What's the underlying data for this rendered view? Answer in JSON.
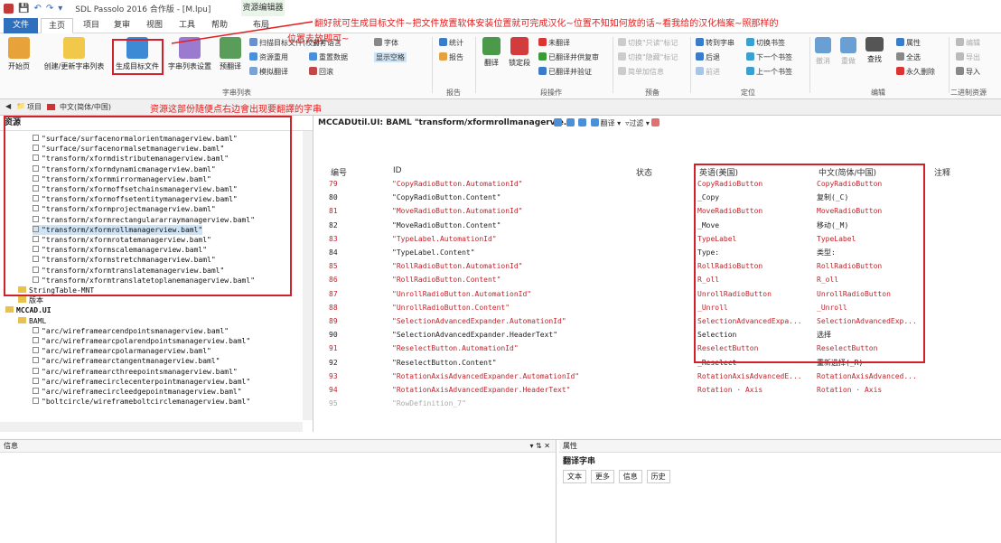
{
  "titlebar": {
    "title": "SDL Passolo 2016 合作版 - [M.lpu]",
    "context_tab": "资源编辑器"
  },
  "tabs": {
    "file": "文件",
    "home": "主页",
    "project": "项目",
    "review": "复审",
    "view": "视图",
    "tools": "工具",
    "help": "帮助",
    "layout": "布局"
  },
  "ribbon": {
    "start": "开始页",
    "create": "创建/更新字串列表",
    "generate": "生成目标文件",
    "list_settings": "字串列表设置",
    "pretranslate": "预翻译",
    "scan": "扫描目标文件(校对)",
    "reuse": "资源重用",
    "simulate": "模拟翻译",
    "ref_lang": "参考语言",
    "reset_data": "重置数据",
    "undo": "回滚",
    "font": "字体",
    "show_space": "显示空格",
    "stats": "统计",
    "report": "报告",
    "translate": "翻译",
    "lock": "锁定段",
    "untranslated": "未翻译",
    "translated_review": "已翻译并供复审",
    "translated_verified": "已翻译并验证",
    "switch_for": "切换\"只读\"标记",
    "switch_hidden": "切换\"隐藏\"标记",
    "add_memo": "简单加信息",
    "goto": "转到字串",
    "toggle_bookmark": "切换书签",
    "back": "后退",
    "next_bookmark": "下一个书签",
    "forward": "前进",
    "prev_bookmark": "上一个书签",
    "undo2": "撤消",
    "redo": "重做",
    "find": "查找",
    "properties": "属性",
    "select_all": "全选",
    "perm_delete": "永久删除",
    "edit": "编辑",
    "export": "导出",
    "import": "导入",
    "groups": {
      "string_list": "字串列表",
      "report": "报告",
      "para_ops": "段操作",
      "pretrans": "预备",
      "locate": "定位",
      "editing": "编辑",
      "binary": "二进制资源"
    }
  },
  "annotations": {
    "top": "翻好就可生成目标文件~把文件放置软体安装位置就可完成汉化~位置不知如何放的话~看我给的汉化档案~照那样的",
    "top2": "位置去放即可~",
    "left": "资源这部份随便点右边會出现要翻譯的字串"
  },
  "docbar": {
    "project": "项目",
    "lang": "中文(简体/中国)"
  },
  "leftpanel": {
    "title": "资源",
    "rows": [
      {
        "text": "\"surface/surfacenormalorientmanagerview.baml\"",
        "kind": "file",
        "indent": 36
      },
      {
        "text": "\"surface/surfacenormalsetmanagerview.baml\"",
        "kind": "file",
        "indent": 36
      },
      {
        "text": "\"transform/xformdistributemanagerview.baml\"",
        "kind": "file",
        "indent": 36
      },
      {
        "text": "\"transform/xformdynamicmanagerview.baml\"",
        "kind": "file",
        "indent": 36
      },
      {
        "text": "\"transform/xformmirrormanagerview.baml\"",
        "kind": "file",
        "indent": 36
      },
      {
        "text": "\"transform/xformoffsetchainsmanagerview.baml\"",
        "kind": "file",
        "indent": 36
      },
      {
        "text": "\"transform/xformoffsetentitymanagerview.baml\"",
        "kind": "file",
        "indent": 36
      },
      {
        "text": "\"transform/xformprojectmanagerview.baml\"",
        "kind": "file",
        "indent": 36
      },
      {
        "text": "\"transform/xformrectangulararraymanagerview.baml\"",
        "kind": "file",
        "indent": 36
      },
      {
        "text": "\"transform/xformrollmanagerview.baml\"",
        "kind": "file",
        "indent": 36,
        "selected": true
      },
      {
        "text": "\"transform/xformrotatemanagerview.baml\"",
        "kind": "file",
        "indent": 36
      },
      {
        "text": "\"transform/xformscalemanagerview.baml\"",
        "kind": "file",
        "indent": 36
      },
      {
        "text": "\"transform/xformstretchmanagerview.baml\"",
        "kind": "file",
        "indent": 36
      },
      {
        "text": "\"transform/xformtranslatemanagerview.baml\"",
        "kind": "file",
        "indent": 36
      },
      {
        "text": "\"transform/xformtranslatetoplanemanagerview.baml\"",
        "kind": "file",
        "indent": 36
      },
      {
        "text": "StringTable-MNT",
        "kind": "folder",
        "indent": 20
      },
      {
        "text": "版本",
        "kind": "folder",
        "indent": 20
      },
      {
        "text": "MCCAD.UI",
        "kind": "root",
        "indent": 6
      },
      {
        "text": "BAML",
        "kind": "folder",
        "indent": 20
      },
      {
        "text": "\"arc/wireframearcendpointsmanagerview.baml\"",
        "kind": "file",
        "indent": 36
      },
      {
        "text": "\"arc/wireframearcpolarendpointsmanagerview.baml\"",
        "kind": "file",
        "indent": 36
      },
      {
        "text": "\"arc/wireframearcpolarmanagerview.baml\"",
        "kind": "file",
        "indent": 36
      },
      {
        "text": "\"arc/wireframearctangentmanagerview.baml\"",
        "kind": "file",
        "indent": 36
      },
      {
        "text": "\"arc/wireframearcthreepointsmanagerview.baml\"",
        "kind": "file",
        "indent": 36
      },
      {
        "text": "\"arc/wireframecirclecenterpointmanagerview.baml\"",
        "kind": "file",
        "indent": 36
      },
      {
        "text": "\"arc/wireframecircleedgepointmanagerview.baml\"",
        "kind": "file",
        "indent": 36
      },
      {
        "text": "\"boltcircle/wireframeboltcirclemanagerview.baml\"",
        "kind": "file",
        "indent": 36
      }
    ]
  },
  "main": {
    "header": "MCCADUtil.UI: BAML \"transform/xformrollmanagervie...",
    "translate_label": "翻译",
    "filter_label": "过滤",
    "columns": {
      "num": "编号",
      "id": "ID",
      "status": "状态",
      "en": "英语(美国)",
      "zh": "中文(简体/中国)",
      "comment": "注释"
    },
    "rows": [
      {
        "num": "79",
        "id": "\"CopyRadioButton.AutomationId\"",
        "en": "CopyRadioButton",
        "zh": "CopyRadioButton",
        "red": true
      },
      {
        "num": "80",
        "id": "\"CopyRadioButton.Content\"",
        "en": "_Copy",
        "zh": "复制(_C)",
        "red": false
      },
      {
        "num": "81",
        "id": "\"MoveRadioButton.AutomationId\"",
        "en": "MoveRadioButton",
        "zh": "MoveRadioButton",
        "red": true
      },
      {
        "num": "82",
        "id": "\"MoveRadioButton.Content\"",
        "en": "_Move",
        "zh": "移动(_M)",
        "red": false
      },
      {
        "num": "83",
        "id": "\"TypeLabel.AutomationId\"",
        "en": "TypeLabel",
        "zh": "TypeLabel",
        "red": true
      },
      {
        "num": "84",
        "id": "\"TypeLabel.Content\"",
        "en": "Type:",
        "zh": "类型:",
        "red": false
      },
      {
        "num": "85",
        "id": "\"RollRadioButton.AutomationId\"",
        "en": "RollRadioButton",
        "zh": "RollRadioButton",
        "red": true
      },
      {
        "num": "86",
        "id": "\"RollRadioButton.Content\"",
        "en": "R_oll",
        "zh": "R_oll",
        "red": true
      },
      {
        "num": "87",
        "id": "\"UnrollRadioButton.AutomationId\"",
        "en": "UnrollRadioButton",
        "zh": "UnrollRadioButton",
        "red": true
      },
      {
        "num": "88",
        "id": "\"UnrollRadioButton.Content\"",
        "en": "_Unroll",
        "zh": "_Unroll",
        "red": true
      },
      {
        "num": "89",
        "id": "\"SelectionAdvancedExpander.AutomationId\"",
        "en": "SelectionAdvancedExpa...",
        "zh": "SelectionAdvancedExp...",
        "red": true
      },
      {
        "num": "90",
        "id": "\"SelectionAdvancedExpander.HeaderText\"",
        "en": "Selection",
        "zh": "选择",
        "red": false
      },
      {
        "num": "91",
        "id": "\"ReselectButton.AutomationId\"",
        "en": "ReselectButton",
        "zh": "ReselectButton",
        "red": true
      },
      {
        "num": "92",
        "id": "\"ReselectButton.Content\"",
        "en": "_Reselect",
        "zh": "重新选择(_R)",
        "red": false
      },
      {
        "num": "93",
        "id": "\"RotationAxisAdvancedExpander.AutomationId\"",
        "en": "RotationAxisAdvancedE...",
        "zh": "RotationAxisAdvanced...",
        "red": true
      },
      {
        "num": "94",
        "id": "\"RotationAxisAdvancedExpander.HeaderText\"",
        "en": "Rotation · Axis",
        "zh": "Rotation · Axis",
        "red": true
      },
      {
        "num": "95",
        "id": "\"RowDefinition_7\"",
        "en": "",
        "zh": "",
        "red": false,
        "faded": true
      }
    ]
  },
  "bottom": {
    "info": "信息",
    "props": "属性",
    "translate_string": "翻译字串",
    "ptabs": [
      "文本",
      "更多",
      "信息",
      "历史"
    ]
  }
}
